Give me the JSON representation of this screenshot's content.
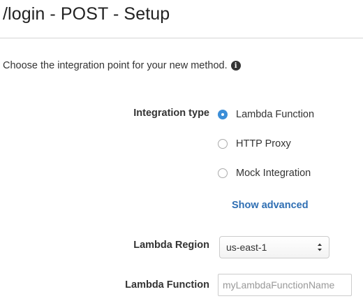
{
  "page": {
    "title": "/login - POST - Setup",
    "intro": "Choose the integration point for your new method.",
    "info_icon": "info-circle-icon"
  },
  "integration": {
    "label": "Integration type",
    "options": [
      {
        "label": "Lambda Function",
        "selected": true
      },
      {
        "label": "HTTP Proxy",
        "selected": false
      },
      {
        "label": "Mock Integration",
        "selected": false
      }
    ],
    "show_advanced": "Show advanced"
  },
  "region": {
    "label": "Lambda Region",
    "value": "us-east-1"
  },
  "function": {
    "label": "Lambda Function",
    "placeholder": "myLambdaFunctionName",
    "value": ""
  },
  "colors": {
    "accent": "#3b8ed8",
    "link": "#2f6fb3"
  }
}
